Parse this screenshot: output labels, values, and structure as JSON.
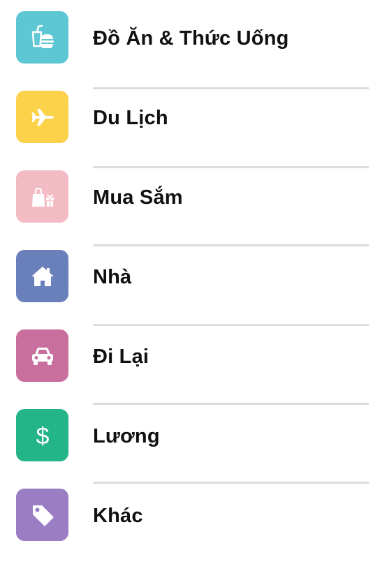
{
  "categories": [
    {
      "label": "Đồ Ăn & Thức Uống",
      "icon": "food-drink-icon",
      "color": "#5DC7D4"
    },
    {
      "label": "Du Lịch",
      "icon": "airplane-icon",
      "color": "#FBD24A"
    },
    {
      "label": "Mua Sắm",
      "icon": "shopping-bag-gift-icon",
      "color": "#F3BBC4"
    },
    {
      "label": "Nhà",
      "icon": "home-icon",
      "color": "#6A80BB"
    },
    {
      "label": "Đi Lại",
      "icon": "car-icon",
      "color": "#C96F9E"
    },
    {
      "label": "Lương",
      "icon": "dollar-icon",
      "color": "#23B488"
    },
    {
      "label": "Khác",
      "icon": "tag-icon",
      "color": "#9A7DC3"
    }
  ]
}
